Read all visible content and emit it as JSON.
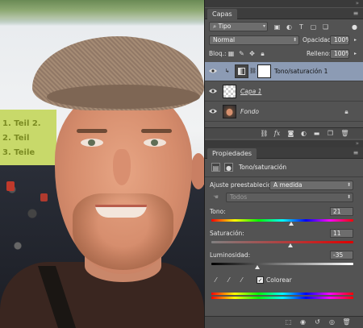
{
  "photo": {
    "banner_lines": [
      "1. Teil 2.",
      "2. Teil",
      "3. Teile"
    ]
  },
  "layers_panel": {
    "tab": "Capas",
    "menu_icon": "panel-menu-icon",
    "filter": {
      "value": "Tipo",
      "icon": "search-icon"
    },
    "filter_icons": [
      "image-filter-icon",
      "adjustment-filter-icon",
      "type-filter-icon",
      "shape-filter-icon",
      "smart-object-filter-icon",
      "filter-toggle-icon"
    ],
    "blend_mode": "Normal",
    "opacity_label": "Opacidad:",
    "opacity_value": "100%",
    "lock_label": "Bloq.:",
    "fill_label": "Relleno:",
    "fill_value": "100%",
    "layers": [
      {
        "name": "Tono/saturación 1",
        "selected": true,
        "type": "adjustment"
      },
      {
        "name": "Capa 1",
        "selected": false,
        "type": "transparent"
      },
      {
        "name": "Fondo",
        "selected": false,
        "type": "background",
        "locked": true
      }
    ],
    "footer_icons": [
      "link-icon",
      "fx-icon",
      "mask-icon",
      "adjustment-icon",
      "group-icon",
      "new-layer-icon",
      "trash-icon"
    ],
    "fx_label": "fx"
  },
  "properties_panel": {
    "tab": "Propiedades",
    "title": "Tono/saturación",
    "preset_label": "Ajuste preestablecido:",
    "preset_value": "A medida",
    "channel_value": "Todos",
    "hue_label": "Tono:",
    "hue_value": "21",
    "hue_fraction": 0.56,
    "saturation_label": "Saturación:",
    "saturation_value": "11",
    "saturation_fraction": 0.555,
    "lightness_label": "Luminosidad:",
    "lightness_value": "-35",
    "lightness_fraction": 0.325,
    "colorize_label": "Colorear",
    "colorize_checked": true,
    "footer_icons": [
      "clip-to-layer-icon",
      "view-previous-icon",
      "reset-icon",
      "visibility-icon",
      "trash-icon"
    ]
  }
}
